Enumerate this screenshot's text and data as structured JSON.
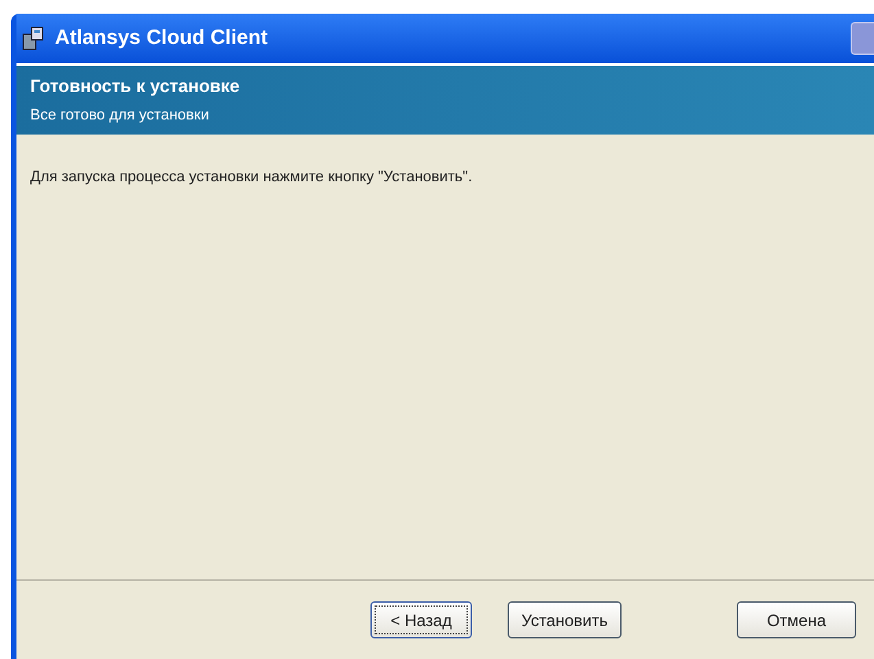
{
  "window": {
    "title": "Atlansys Cloud Client"
  },
  "header": {
    "title": "Готовность к установке",
    "subtitle": "Все готово для установки"
  },
  "body": {
    "text": "Для запуска процесса установки нажмите кнопку \"Установить\"."
  },
  "buttons": [
    {
      "label": "< Назад",
      "focused": true
    },
    {
      "label": "Установить",
      "focused": false
    },
    {
      "label": "Отмена",
      "focused": false
    }
  ]
}
